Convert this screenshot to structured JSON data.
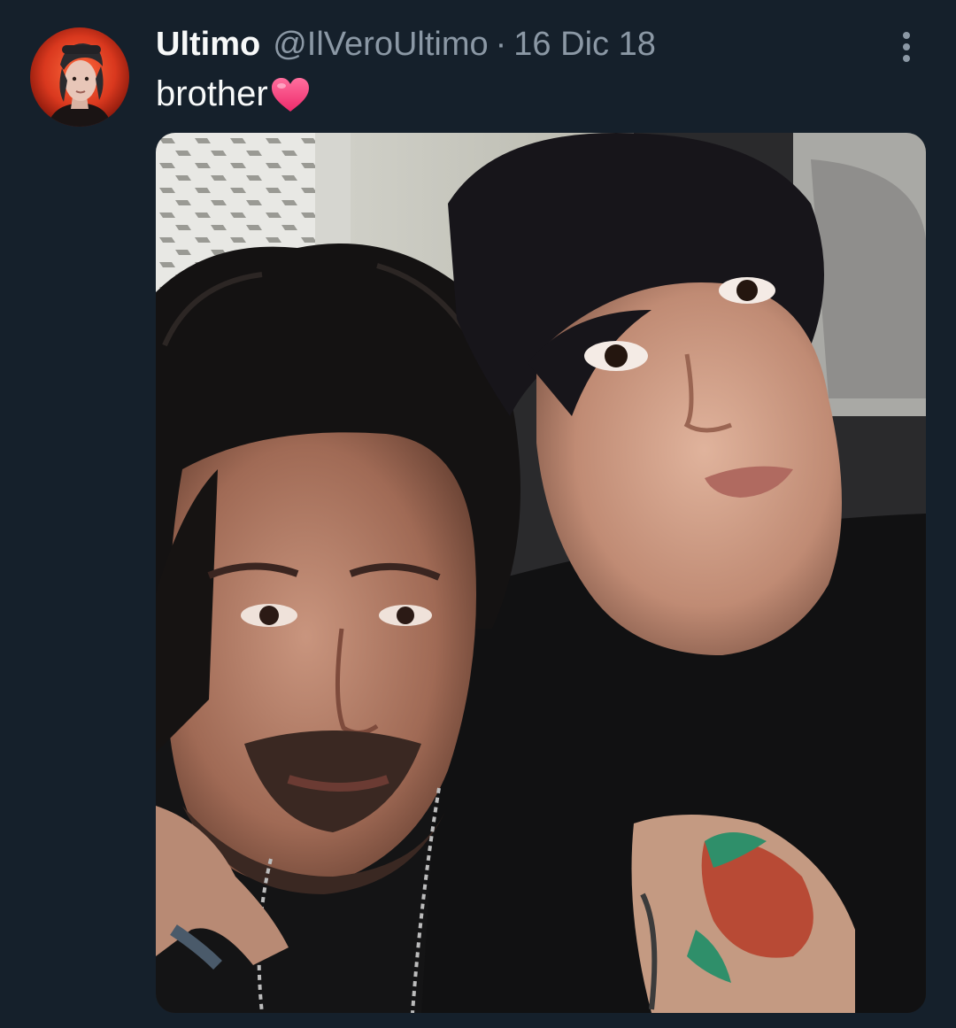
{
  "tweet": {
    "display_name": "Ultimo",
    "handle": "@IlVeroUltimo",
    "separator": "·",
    "date": "16 Dic 18",
    "text": "brother",
    "emoji": "red-heart-icon"
  },
  "icons": {
    "more": "more-vertical-icon",
    "heart": "heart-emoji-icon"
  },
  "colors": {
    "background": "#15202b",
    "primary_text": "#f7f9f9",
    "secondary_text": "#8b98a5",
    "heart": "#f4357e"
  }
}
